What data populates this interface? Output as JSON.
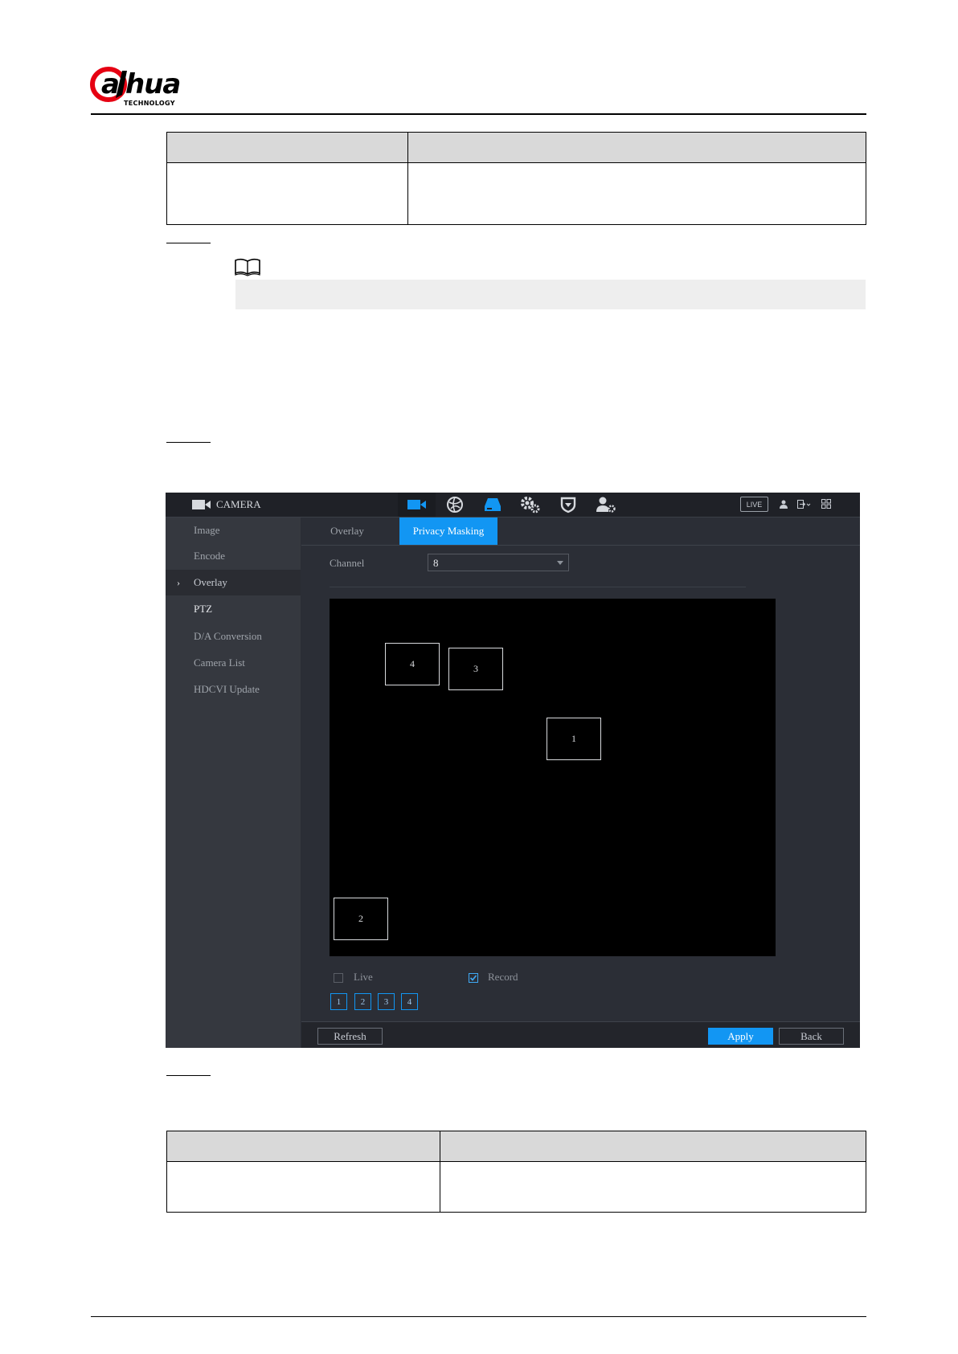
{
  "header": {
    "logo_text": "alhua",
    "logo_subtext": "TECHNOLOGY",
    "logo_accent": "#e60012"
  },
  "camera_ui": {
    "title": "CAMERA",
    "live_label": "LIVE",
    "nav_icons": [
      "camera-icon",
      "network-globe-icon",
      "storage-icon",
      "system-gears-icon",
      "security-shield-icon",
      "account-icon"
    ],
    "sidebar": [
      {
        "label": "Image"
      },
      {
        "label": "Encode"
      },
      {
        "label": "Overlay",
        "active": true
      },
      {
        "label": "PTZ"
      },
      {
        "label": "D/A Conversion"
      },
      {
        "label": "Camera List"
      },
      {
        "label": "HDCVI Update"
      }
    ],
    "tabs": [
      {
        "label": "Overlay"
      },
      {
        "label": "Privacy Masking",
        "active": true
      }
    ],
    "channel_label": "Channel",
    "channel_value": "8",
    "mask_regions": [
      {
        "label": "4"
      },
      {
        "label": "3"
      },
      {
        "label": "1"
      },
      {
        "label": "2"
      }
    ],
    "live_checkbox": {
      "label": "Live",
      "checked": false
    },
    "record_checkbox": {
      "label": "Record",
      "checked": true
    },
    "region_buttons": [
      "1",
      "2",
      "3",
      "4"
    ],
    "buttons": {
      "refresh": "Refresh",
      "apply": "Apply",
      "back": "Back"
    },
    "accent_color": "#1296f3"
  }
}
